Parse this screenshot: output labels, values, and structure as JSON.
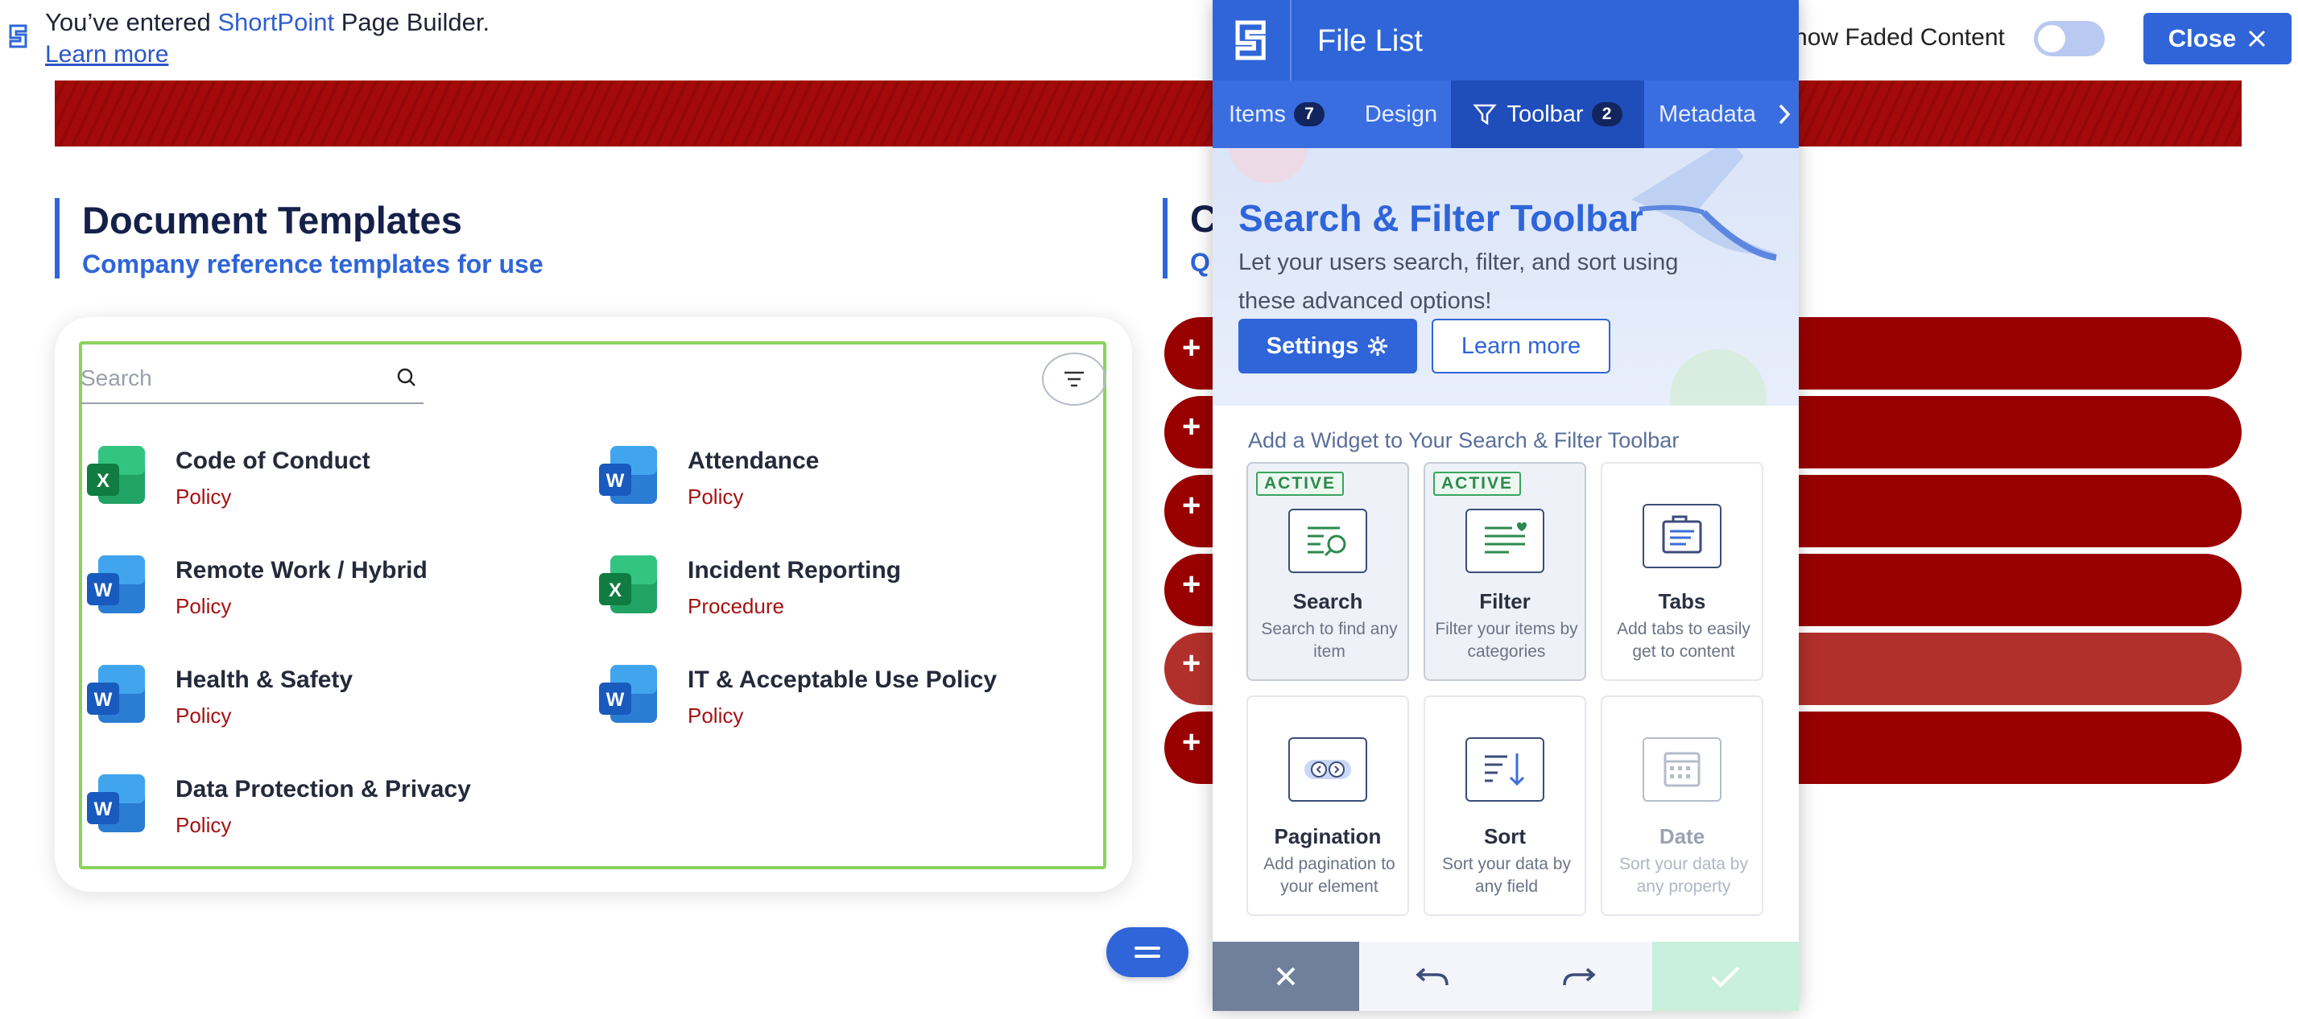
{
  "topbar": {
    "message_prefix": "You’ve entered",
    "message_brand": "ShortPoint",
    "message_suffix": "Page Builder.",
    "learn_more": "Learn more",
    "faded_label": "Show Faded Content",
    "close_label": "Close"
  },
  "section_left": {
    "title": "Document Templates",
    "subtitle": "Company reference templates for use"
  },
  "section_right": {
    "title_fragment": "C",
    "subtitle_fragment": "Q"
  },
  "file_list": {
    "search_placeholder": "Search",
    "items": [
      {
        "name": "Code of Conduct",
        "category": "Policy",
        "type": "excel"
      },
      {
        "name": "Attendance",
        "category": "Policy",
        "type": "word"
      },
      {
        "name": "Remote Work / Hybrid",
        "category": "Policy",
        "type": "word"
      },
      {
        "name": "Incident Reporting",
        "category": "Procedure",
        "type": "excel"
      },
      {
        "name": "Health & Safety",
        "category": "Policy",
        "type": "word"
      },
      {
        "name": "IT & Acceptable Use Policy",
        "category": "Policy",
        "type": "word"
      },
      {
        "name": "Data Protection & Privacy",
        "category": "Policy",
        "type": "word"
      }
    ]
  },
  "accordion": {
    "plus": "+"
  },
  "panel": {
    "title": "File List",
    "tabs": [
      {
        "label": "Items",
        "badge": "7"
      },
      {
        "label": "Design",
        "badge": ""
      },
      {
        "label": "Toolbar",
        "badge": "2"
      },
      {
        "label": "Metadata",
        "badge": ""
      }
    ],
    "hero": {
      "title": "Search & Filter Toolbar",
      "description": "Let your users search, filter, and sort using these advanced options!",
      "settings_label": "Settings",
      "learn_more_label": "Learn more"
    },
    "add_widget_title": "Add a Widget to Your Search & Filter Toolbar",
    "active_label": "ACTIVE",
    "widgets": [
      {
        "name": "Search",
        "description": "Search to find any item",
        "active": true,
        "icon": "search-widget-icon"
      },
      {
        "name": "Filter",
        "description": "Filter your items by categories",
        "active": true,
        "icon": "filter-widget-icon"
      },
      {
        "name": "Tabs",
        "description": "Add tabs to easily get to content",
        "active": false,
        "icon": "tabs-widget-icon"
      },
      {
        "name": "Pagination",
        "description": "Add pagination to your element",
        "active": false,
        "icon": "pagination-widget-icon"
      },
      {
        "name": "Sort",
        "description": "Sort your data by any field",
        "active": false,
        "icon": "sort-widget-icon"
      },
      {
        "name": "Date",
        "description": "Sort your data by any property",
        "active": false,
        "icon": "date-widget-icon"
      }
    ]
  },
  "colors": {
    "brand_blue": "#2f65d8",
    "accordion_red": "#990000",
    "category_red": "#a51212",
    "card_border_green": "#8bd35d",
    "active_green": "#3aa45e"
  }
}
